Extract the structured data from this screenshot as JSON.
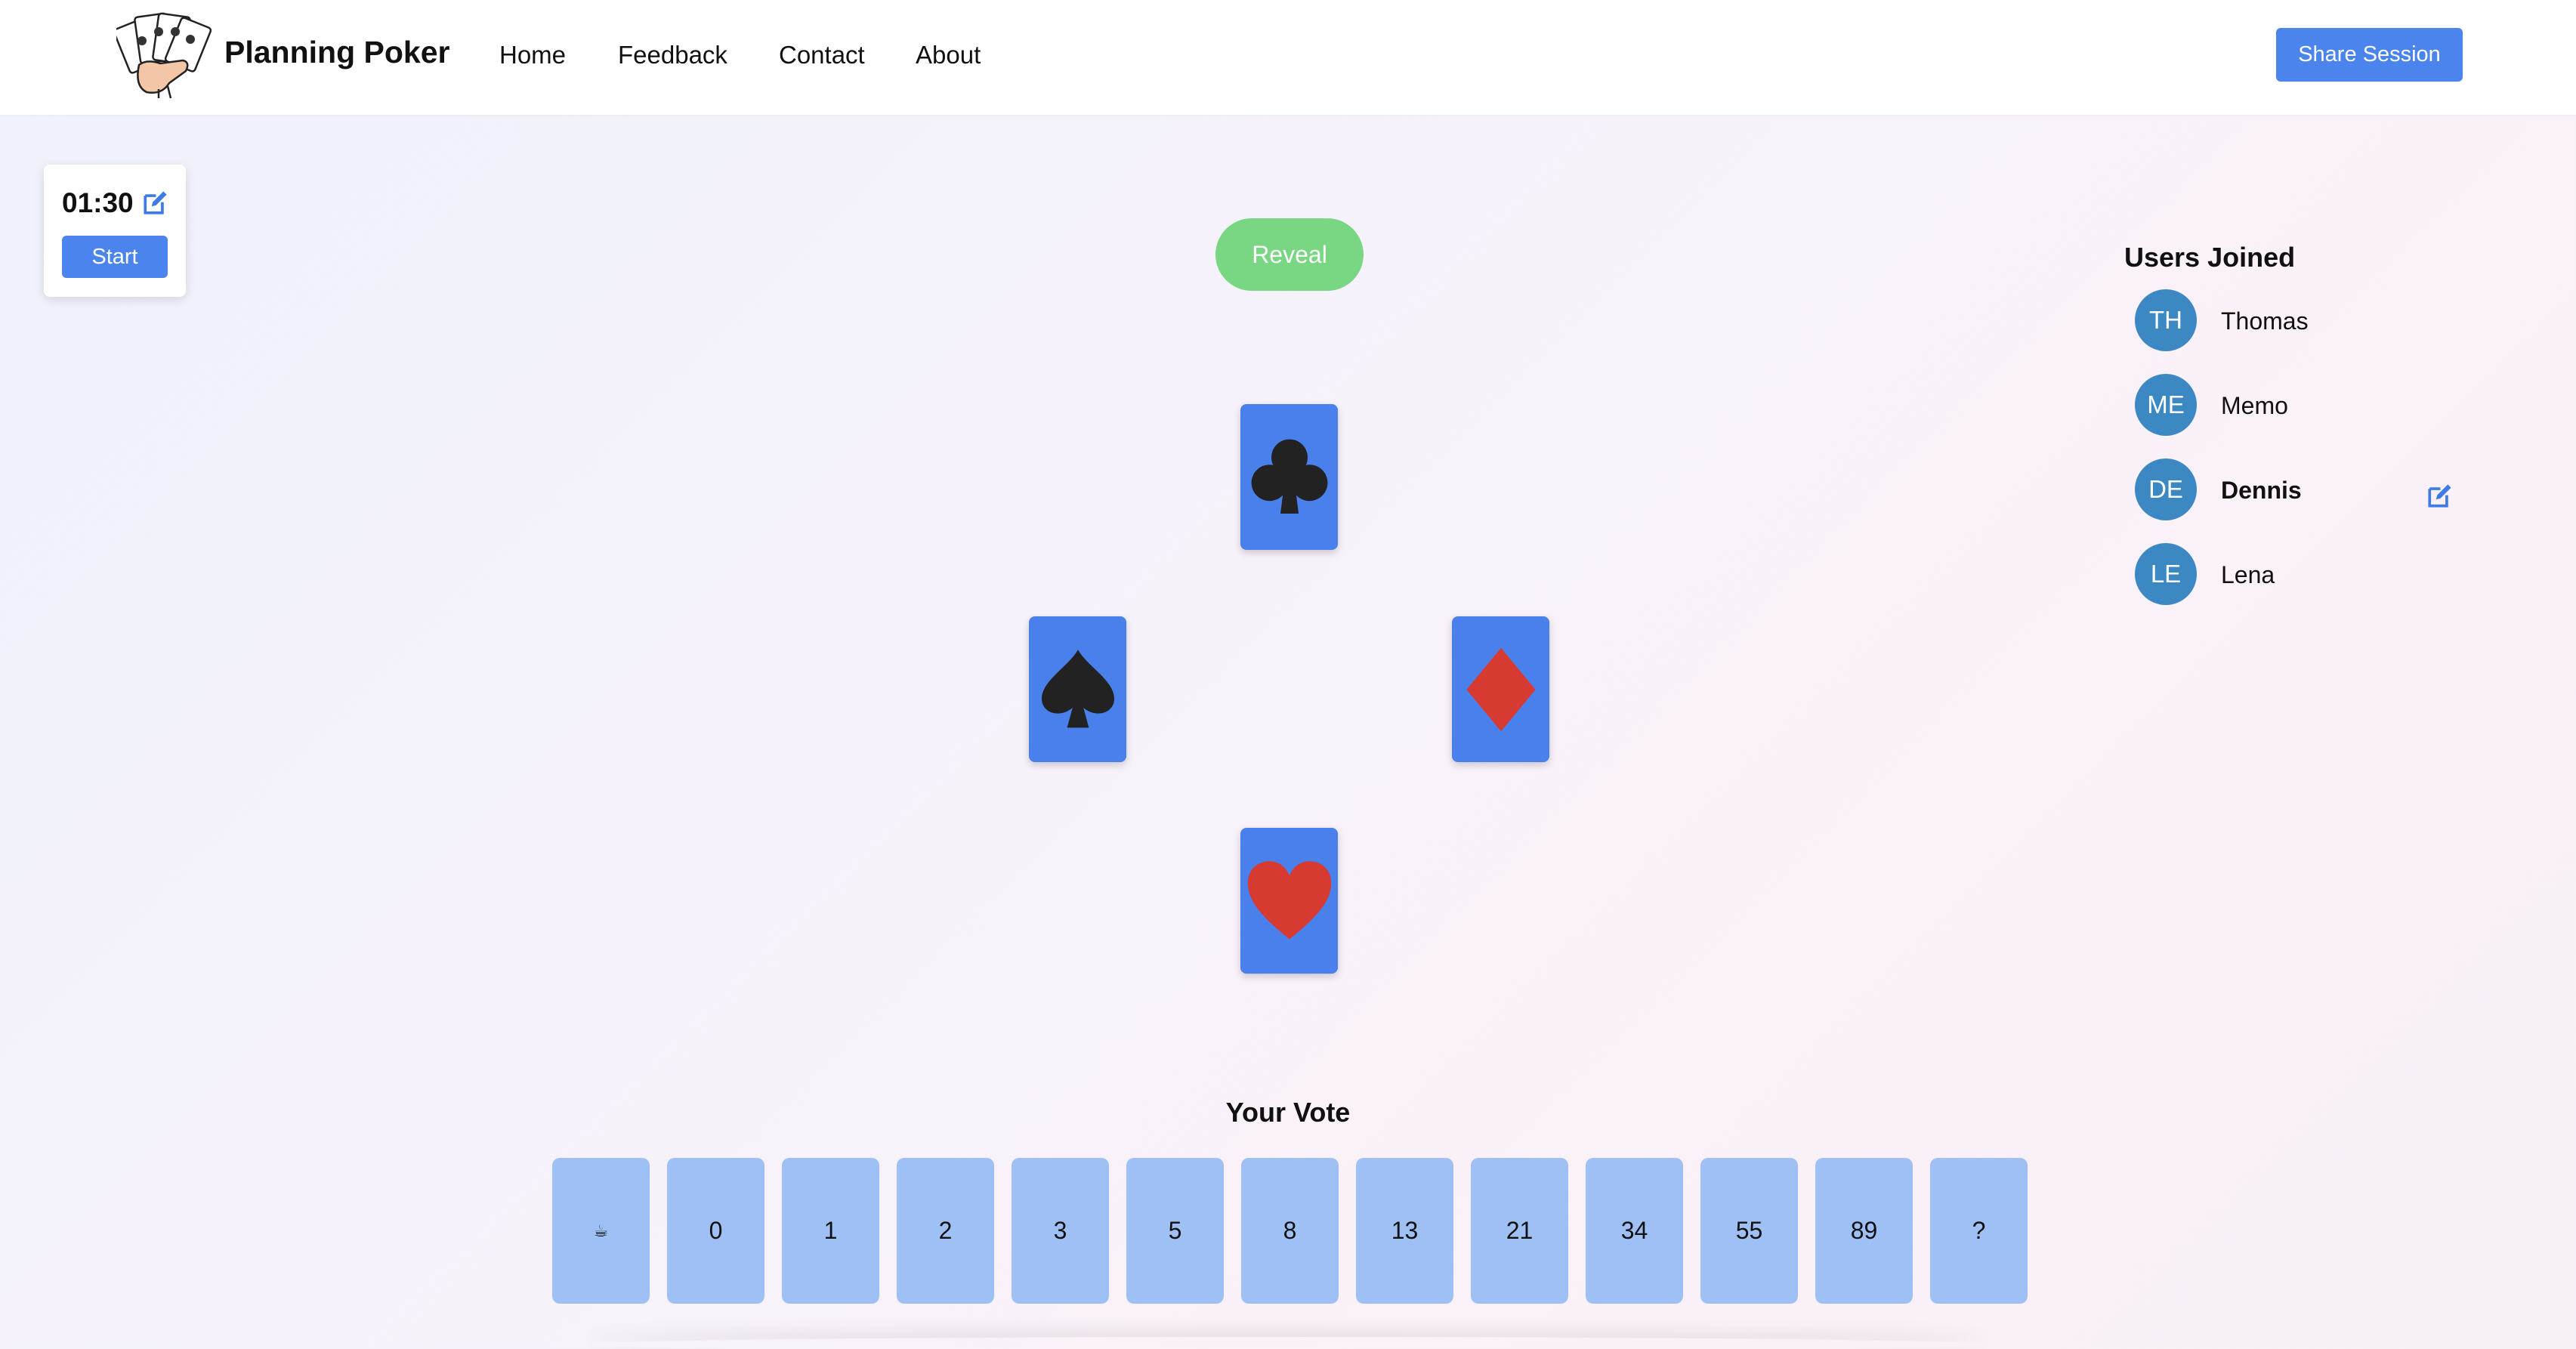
{
  "header": {
    "brand": "Planning Poker",
    "nav": [
      "Home",
      "Feedback",
      "Contact",
      "About"
    ],
    "share_label": "Share Session"
  },
  "timer": {
    "time": "01:30",
    "start_label": "Start"
  },
  "reveal_label": "Reveal",
  "played_cards": [
    "club",
    "spade",
    "diamond",
    "heart"
  ],
  "users": {
    "title": "Users Joined",
    "list": [
      {
        "initials": "TH",
        "name": "Thomas"
      },
      {
        "initials": "ME",
        "name": "Memo"
      },
      {
        "initials": "DE",
        "name": "Dennis"
      },
      {
        "initials": "LE",
        "name": "Lena"
      }
    ]
  },
  "vote": {
    "title": "Your Vote",
    "options": [
      "☕",
      "0",
      "1",
      "2",
      "3",
      "5",
      "8",
      "13",
      "21",
      "34",
      "55",
      "89",
      "?"
    ]
  },
  "colors": {
    "primary": "#4a84ec",
    "reveal": "#79d683",
    "card": "#4a80ec",
    "vote_card": "#9ec0f5",
    "avatar": "#3b88c3"
  }
}
